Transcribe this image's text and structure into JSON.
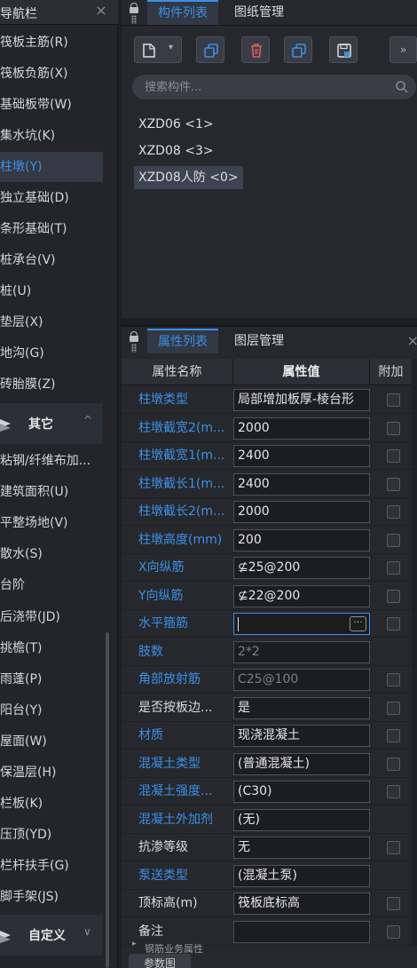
{
  "nav": {
    "title": "导航栏",
    "close": "×",
    "items": [
      {
        "label": "筏板主筋(R)"
      },
      {
        "label": "筏板负筋(X)"
      },
      {
        "label": "基础板带(W)"
      },
      {
        "label": "集水坑(K)"
      },
      {
        "label": "柱墩(Y)",
        "active": true
      },
      {
        "label": "独立基础(D)"
      },
      {
        "label": "条形基础(T)"
      },
      {
        "label": "桩承台(V)"
      },
      {
        "label": "桩(U)"
      },
      {
        "label": "垫层(X)"
      },
      {
        "label": "地沟(G)"
      },
      {
        "label": "砖胎膜(Z)"
      }
    ],
    "group_other": {
      "label": "其它",
      "chevron": "^"
    },
    "other_items": [
      {
        "label": "粘钢/纤维布加..."
      },
      {
        "label": "建筑面积(U)"
      },
      {
        "label": "平整场地(V)"
      },
      {
        "label": "散水(S)"
      },
      {
        "label": "台阶"
      },
      {
        "label": "后浇带(JD)"
      },
      {
        "label": "挑檐(T)"
      },
      {
        "label": "雨蓬(P)"
      },
      {
        "label": "阳台(Y)"
      },
      {
        "label": "屋面(W)"
      },
      {
        "label": "保温层(H)"
      },
      {
        "label": "栏板(K)"
      },
      {
        "label": "压顶(YD)"
      },
      {
        "label": "栏杆扶手(G)"
      },
      {
        "label": "脚手架(JS)"
      }
    ],
    "group_custom": {
      "label": "自定义",
      "chevron": "∨"
    }
  },
  "components": {
    "tabs": [
      {
        "label": "构件列表",
        "active": true
      },
      {
        "label": "图纸管理"
      }
    ],
    "toolbar": [
      "new-icon",
      "copy-icon",
      "delete-icon",
      "layer-copy-icon",
      "save-icon"
    ],
    "overflow": "»",
    "search_placeholder": "搜索构件...",
    "list": [
      {
        "label": "XZD06 <1>"
      },
      {
        "label": "XZD08 <3>"
      },
      {
        "label": "XZD08人防 <0>",
        "active": true
      }
    ]
  },
  "properties": {
    "tabs": [
      {
        "label": "属性列表",
        "active": true
      },
      {
        "label": "图层管理"
      }
    ],
    "close": "×",
    "headers": {
      "name": "属性名称",
      "value": "属性值",
      "extra": "附加"
    },
    "rows": [
      {
        "name": "柱墩类型",
        "value": "局部增加板厚-棱台形",
        "blue": true,
        "check": true
      },
      {
        "name": "柱墩截宽2(m...",
        "value": "2000",
        "blue": true,
        "check": true
      },
      {
        "name": "柱墩截宽1(m...",
        "value": "2400",
        "blue": true,
        "check": true
      },
      {
        "name": "柱墩截长1(m...",
        "value": "2400",
        "blue": true,
        "check": true
      },
      {
        "name": "柱墩截长2(m...",
        "value": "2000",
        "blue": true,
        "check": true
      },
      {
        "name": "柱墩高度(mm)",
        "value": "200",
        "blue": true,
        "check": true
      },
      {
        "name": "X向纵筋",
        "value": "⊈25@200",
        "blue": true,
        "check": true
      },
      {
        "name": "Y向纵筋",
        "value": "⊈22@200",
        "blue": true,
        "check": true
      },
      {
        "name": "水平箍筋",
        "value": "",
        "blue": true,
        "check": true,
        "editing": true,
        "ellipsis": "···"
      },
      {
        "name": "肢数",
        "value": "2*2",
        "blue": true,
        "check": false,
        "dim": true
      },
      {
        "name": "角部放射筋",
        "value": "C25@100",
        "blue": true,
        "check": true,
        "dim": true
      },
      {
        "name": "是否按板边...",
        "value": "是",
        "blue": false,
        "check": true
      },
      {
        "name": "材质",
        "value": "现浇混凝土",
        "blue": true,
        "check": true
      },
      {
        "name": "混凝土类型",
        "value": "(普通混凝土)",
        "blue": true,
        "check": true
      },
      {
        "name": "混凝土强度...",
        "value": "(C30)",
        "blue": true,
        "check": true
      },
      {
        "name": "混凝土外加剂",
        "value": "(无)",
        "blue": true,
        "check": false
      },
      {
        "name": "抗渗等级",
        "value": "无",
        "blue": false,
        "check": true
      },
      {
        "name": "泵送类型",
        "value": "(混凝土泵)",
        "blue": true,
        "check": false
      },
      {
        "name": "顶标高(m)",
        "value": "筏板底标高",
        "blue": false,
        "check": true
      },
      {
        "name": "备注",
        "value": "",
        "blue": false,
        "check": true
      }
    ],
    "more_row": "钢筋业务属性",
    "bottom_tab": "参数图"
  }
}
